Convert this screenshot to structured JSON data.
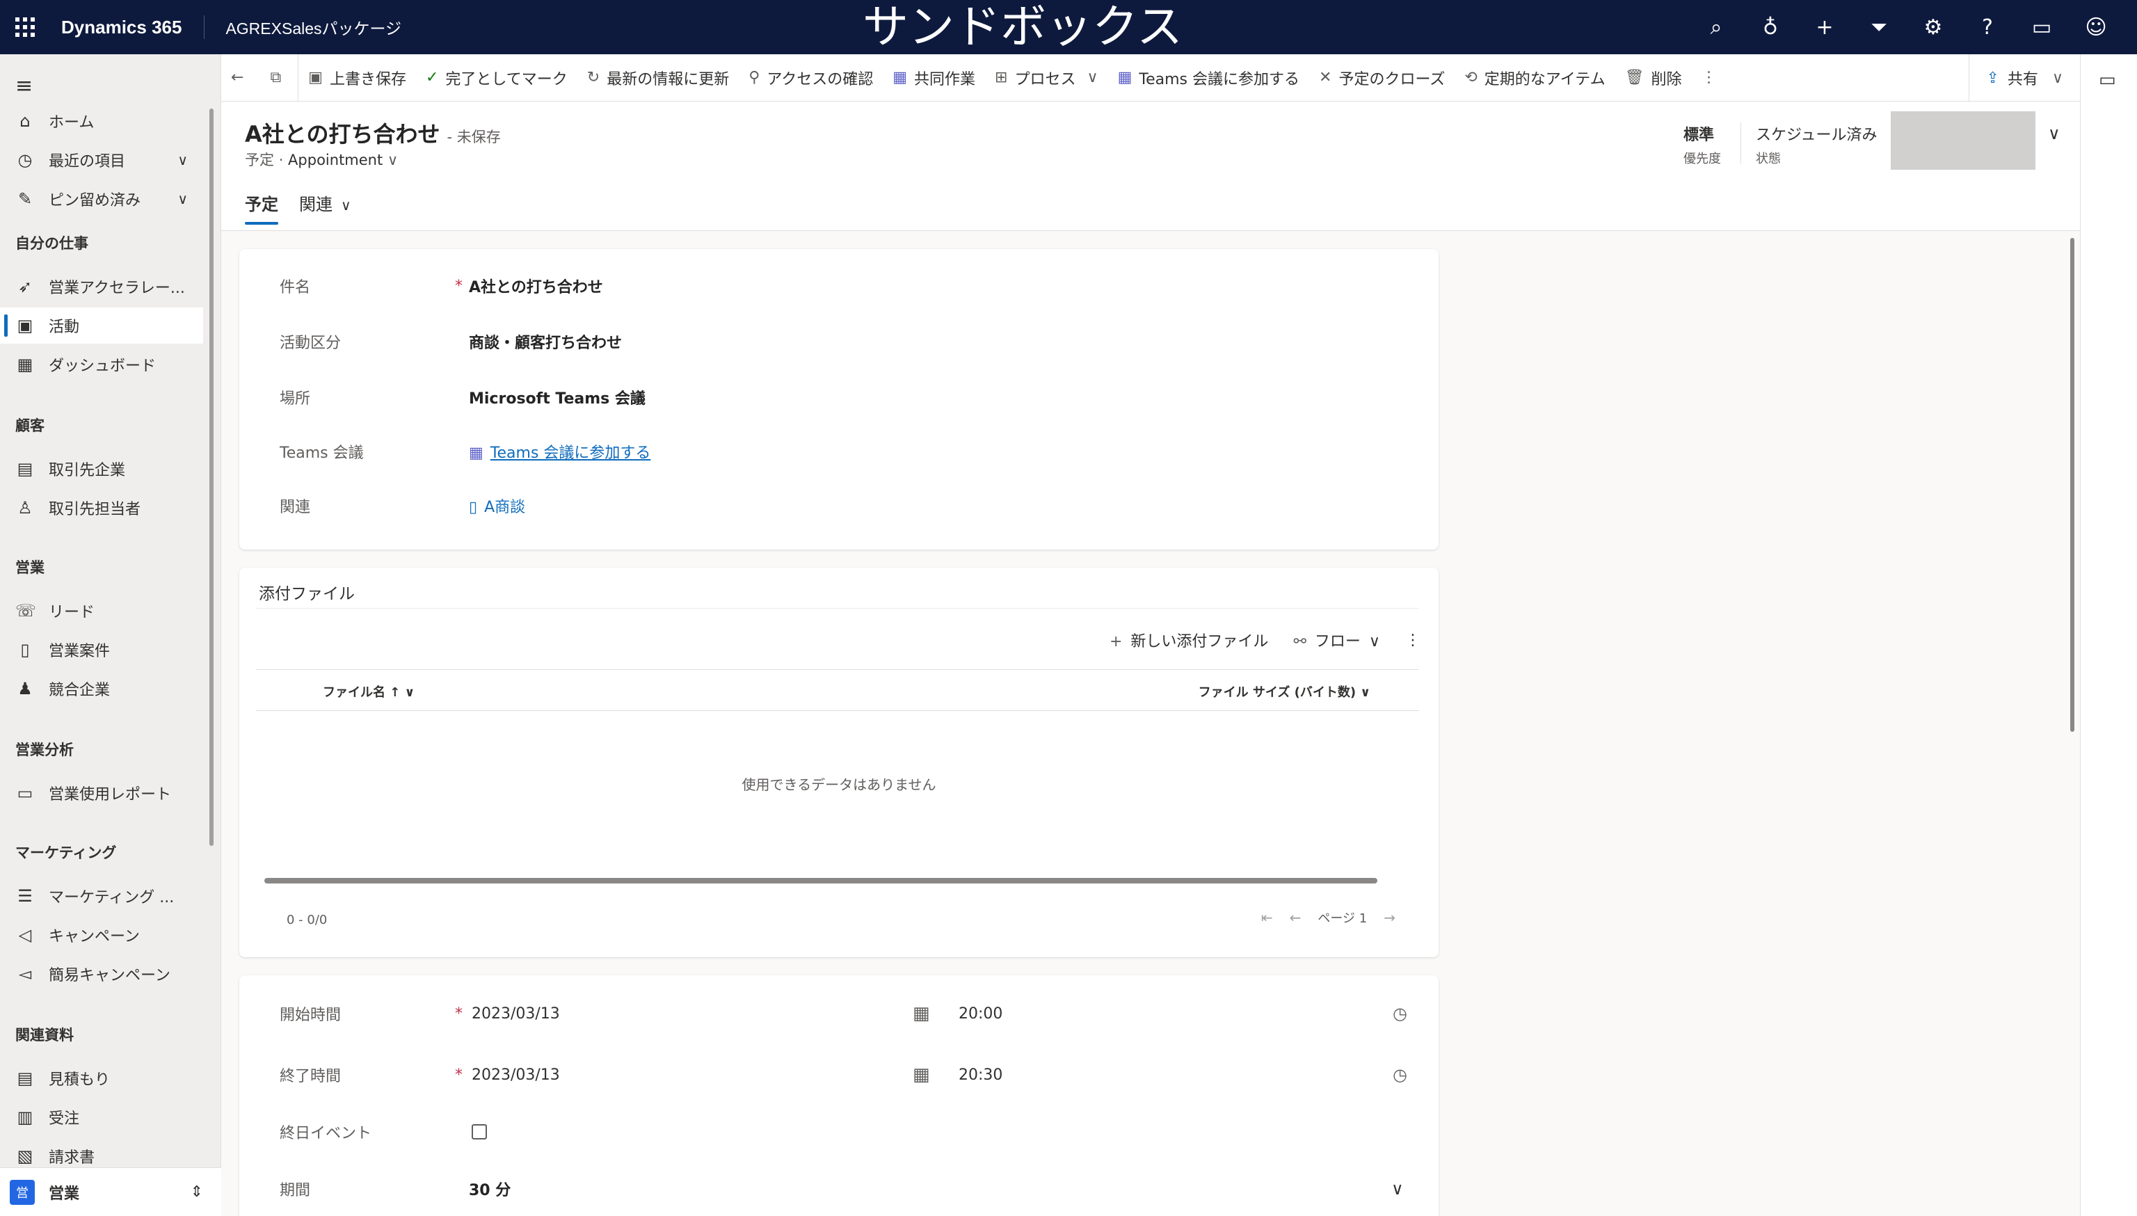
{
  "topbar": {
    "brand": "Dynamics 365",
    "app_name": "AGREXSalesパッケージ",
    "environment_banner": "サンドボックス",
    "icons": [
      "search-icon",
      "lightbulb-icon",
      "plus-icon",
      "filter-icon",
      "gear-icon",
      "help-icon",
      "chat-icon",
      "person-feedback-icon"
    ]
  },
  "nav": {
    "items_top": [
      {
        "label": "ホーム",
        "icon": "home-icon"
      },
      {
        "label": "最近の項目",
        "icon": "clock-icon"
      },
      {
        "label": "ピン留め済み",
        "icon": "pin-icon"
      }
    ],
    "sections": {
      "my_work": "自分の仕事",
      "customers": "顧客",
      "sales": "営業",
      "sales_analysis": "営業分析",
      "marketing": "マーケティング",
      "collateral": "関連資料"
    },
    "my_work_items": [
      {
        "label": "営業アクセラレー...",
        "icon": "rocket-icon"
      },
      {
        "label": "活動",
        "icon": "activity-icon"
      },
      {
        "label": "ダッシュボード",
        "icon": "dashboard-icon"
      }
    ],
    "customer_items": [
      {
        "label": "取引先企業",
        "icon": "building-icon"
      },
      {
        "label": "取引先担当者",
        "icon": "person-icon"
      }
    ],
    "sales_items": [
      {
        "label": "リード",
        "icon": "phone-person-icon"
      },
      {
        "label": "営業案件",
        "icon": "opportunity-icon"
      },
      {
        "label": "競合企業",
        "icon": "competitor-icon"
      }
    ],
    "analysis_items": [
      {
        "label": "営業使用レポート",
        "icon": "report-icon"
      }
    ],
    "marketing_items": [
      {
        "label": "マーケティング ...",
        "icon": "list-icon"
      },
      {
        "label": "キャンペーン",
        "icon": "megaphone-icon"
      },
      {
        "label": "簡易キャンペーン",
        "icon": "quick-campaign-icon"
      }
    ],
    "collateral_items": [
      {
        "label": "見積もり",
        "icon": "quote-icon"
      },
      {
        "label": "受注",
        "icon": "order-icon"
      },
      {
        "label": "請求書",
        "icon": "invoice-icon"
      }
    ],
    "area": {
      "badge": "営",
      "label": "営業"
    }
  },
  "commands": [
    {
      "label": "",
      "icon": "back-arrow-icon"
    },
    {
      "label": "",
      "icon": "popout-icon"
    },
    {
      "label": "上書き保存",
      "icon": "save-icon"
    },
    {
      "label": "完了としてマーク",
      "icon": "check-icon"
    },
    {
      "label": "最新の情報に更新",
      "icon": "refresh-icon"
    },
    {
      "label": "アクセスの確認",
      "icon": "key-search-icon"
    },
    {
      "label": "共同作業",
      "icon": "teams-icon"
    },
    {
      "label": "プロセス",
      "icon": "process-icon"
    },
    {
      "label": "Teams 会議に参加する",
      "icon": "teams-icon"
    },
    {
      "label": "予定のクローズ",
      "icon": "close-icon"
    },
    {
      "label": "定期的なアイテム",
      "icon": "recurring-icon"
    },
    {
      "label": "削除",
      "icon": "delete-icon"
    }
  ],
  "share_label": "共有",
  "record": {
    "title": "A社との打ち合わせ",
    "unsaved": "- 未保存",
    "entity": "予定",
    "form": "Appointment",
    "tabs": [
      "予定",
      "関連"
    ],
    "priority_value": "標準",
    "priority_label": "優先度",
    "status_value": "スケジュール済み",
    "status_label": "状態"
  },
  "general": {
    "subject_label": "件名",
    "subject_value": "A社との打ち合わせ",
    "category_label": "活動区分",
    "category_value": "商談・顧客打ち合わせ",
    "location_label": "場所",
    "location_value": "Microsoft Teams 会議",
    "teams_label": "Teams 会議",
    "teams_value": "Teams 会議に参加する",
    "regarding_label": "関連",
    "regarding_value": "A商談"
  },
  "attachments": {
    "title": "添付ファイル",
    "new_label": "新しい添付ファイル",
    "flow_label": "フロー",
    "col_name": "ファイル名",
    "col_size": "ファイル サイズ (バイト数)",
    "empty": "使用できるデータはありません",
    "count": "0 - 0/0",
    "page": "ページ 1"
  },
  "schedule": {
    "start_label": "開始時間",
    "start_date": "2023/03/13",
    "start_time": "20:00",
    "end_label": "終了時間",
    "end_date": "2023/03/13",
    "end_time": "20:30",
    "allday_label": "終日イベント",
    "duration_label": "期間",
    "duration_value": "30 分"
  }
}
